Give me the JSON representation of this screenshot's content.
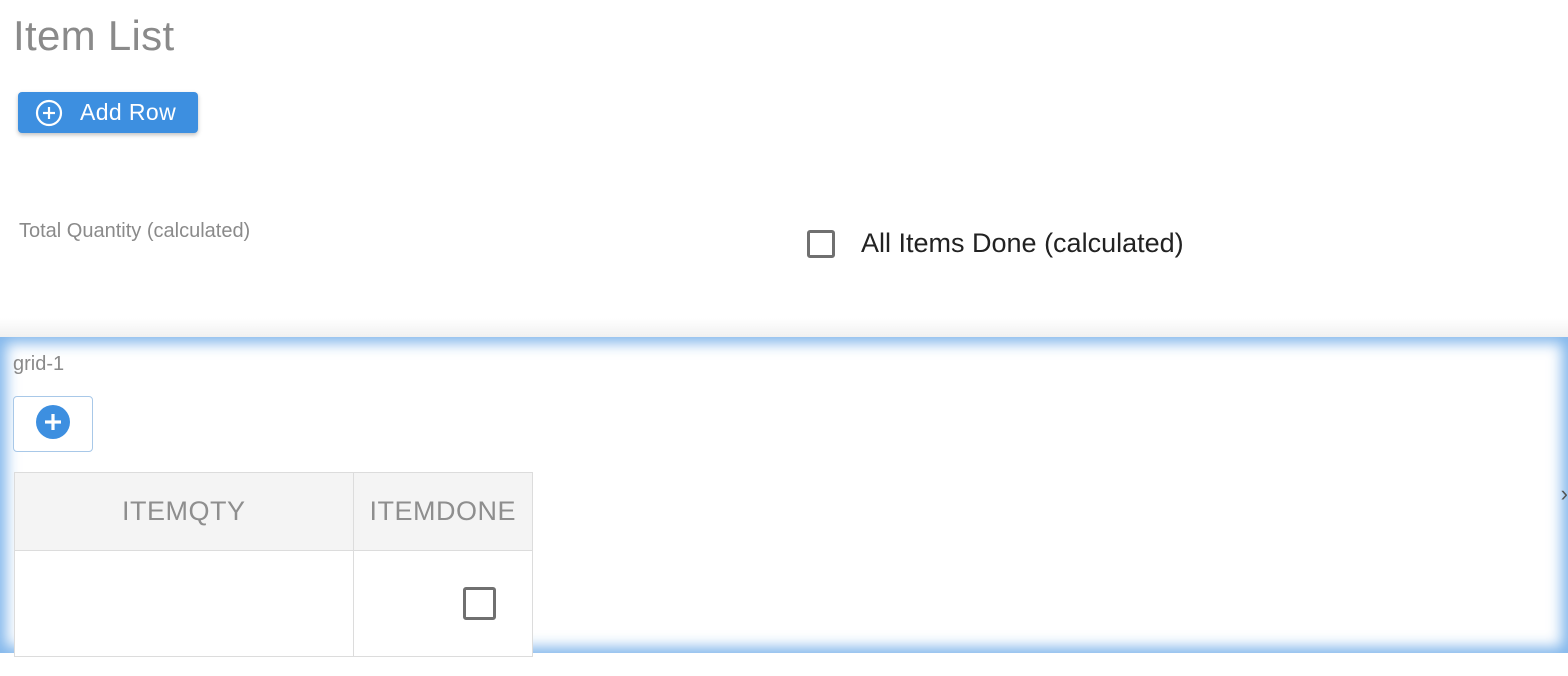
{
  "page": {
    "title": "Item List"
  },
  "toolbar": {
    "add_row_label": "Add Row",
    "add_row_icon": "plus-circle-outline-icon"
  },
  "fields": {
    "total_quantity_label": "Total Quantity (calculated)",
    "all_items_done_label": "All Items Done (calculated)",
    "all_items_done_checked": false
  },
  "grid": {
    "label": "grid-1",
    "add_icon": "plus-circle-filled-icon",
    "columns": [
      "ITEMQTY",
      "ITEMDONE"
    ],
    "rows": [
      {
        "itemqty": "",
        "itemdone": false
      }
    ]
  },
  "colors": {
    "primary": "#3d8fe0",
    "muted_text": "#8a8a8a",
    "header_bg": "#f4f4f4",
    "border": "#dcdcdc"
  }
}
